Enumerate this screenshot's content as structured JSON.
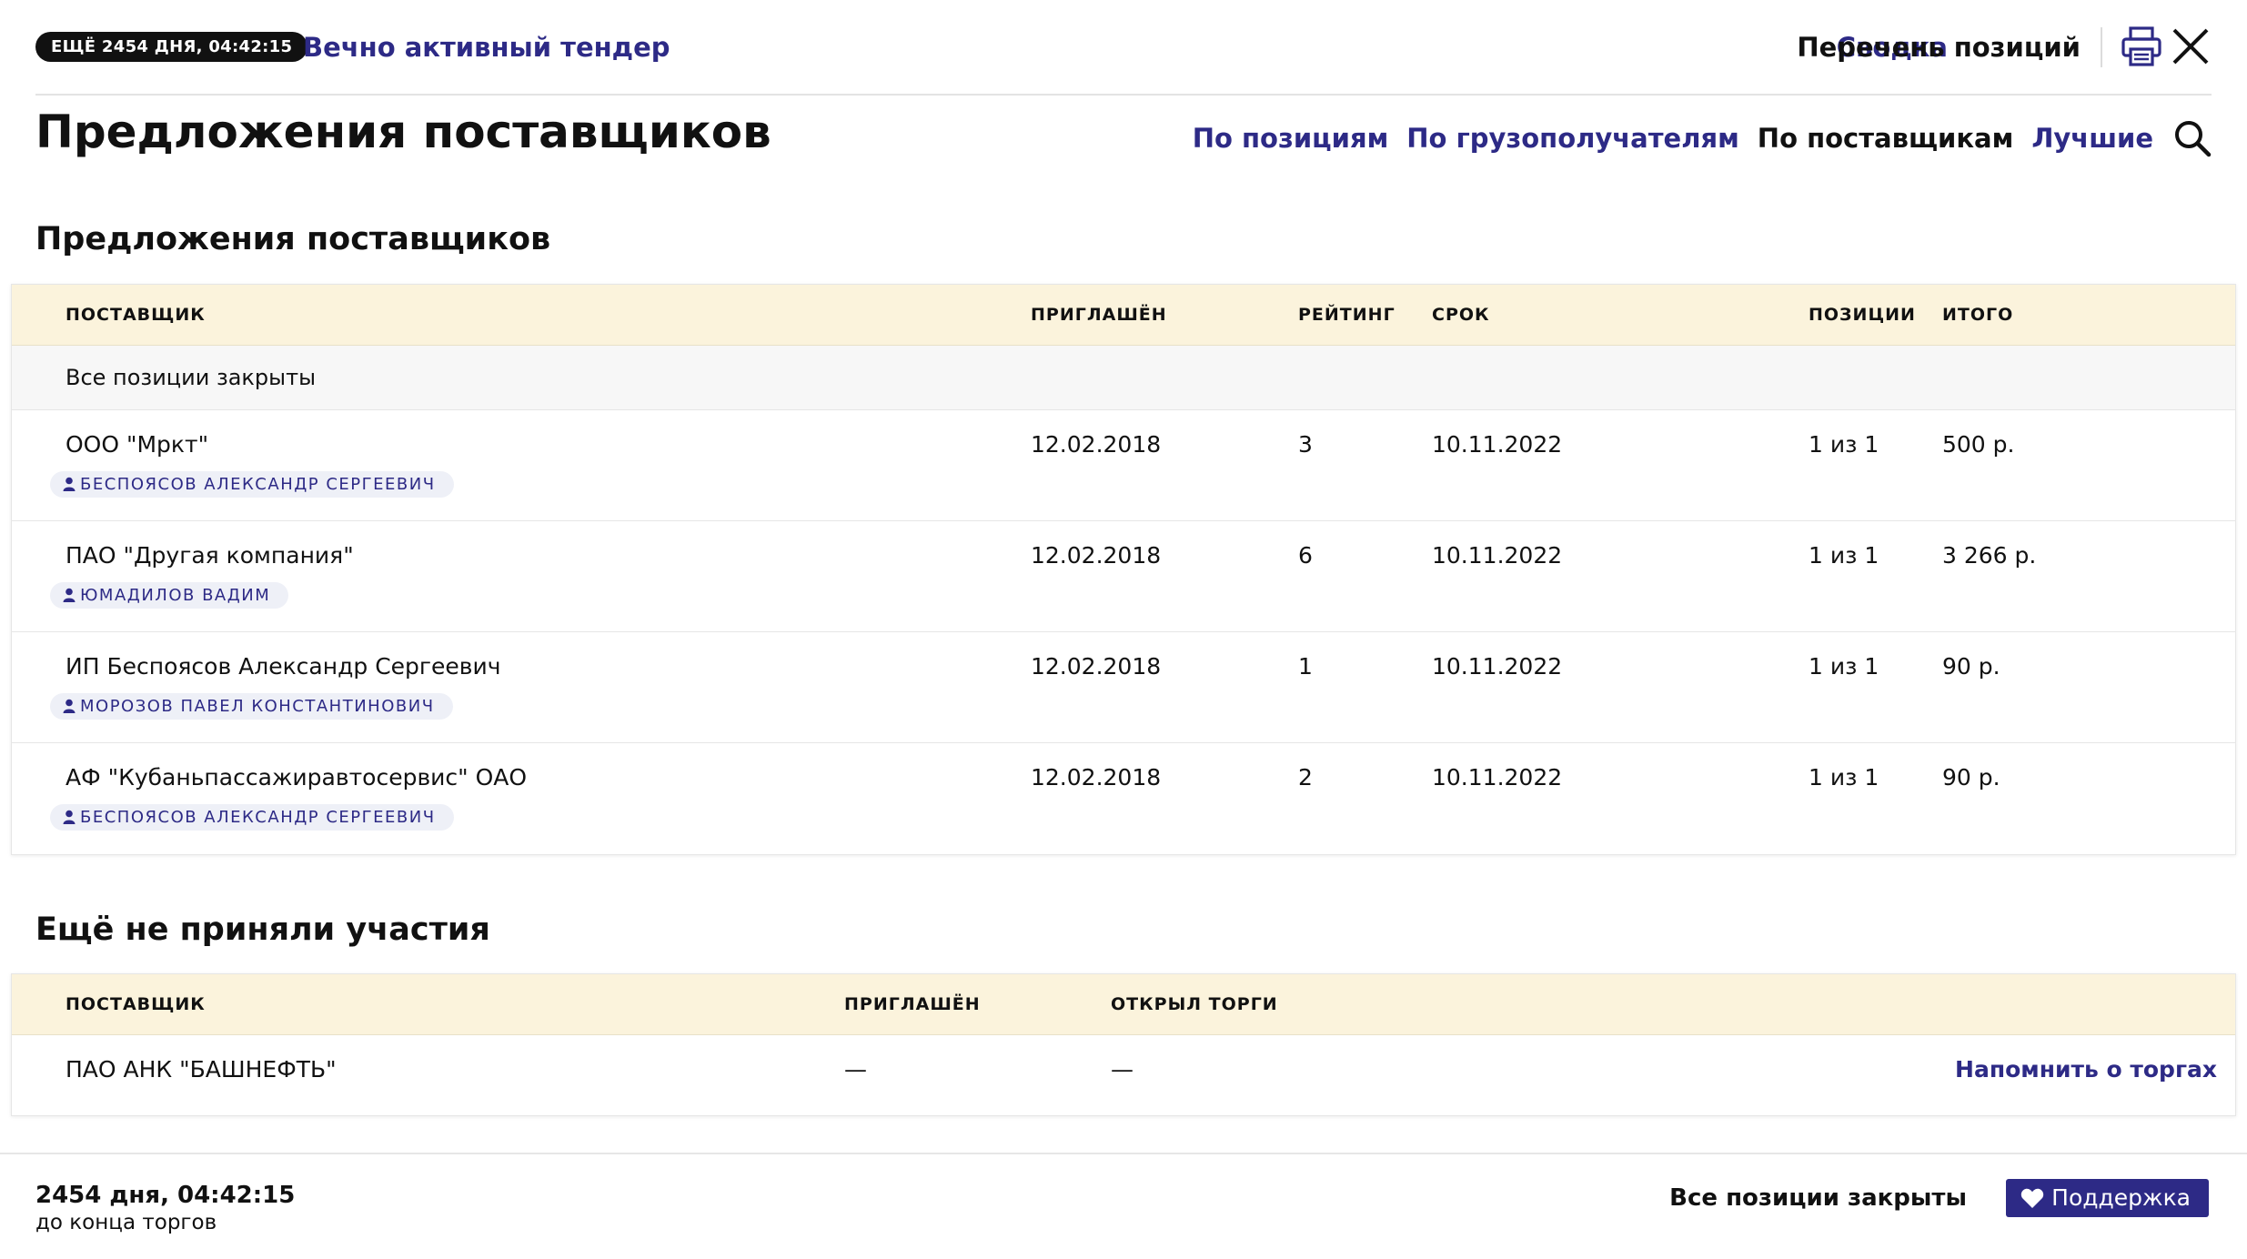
{
  "header": {
    "timer_badge": "ЕЩЁ 2454 ДНЯ, 04:42:15",
    "tender_title": "Вечно активный тендер",
    "nav_summary": "Сводка",
    "nav_positions_list": "Перечень позиций",
    "icons": {
      "print": "print-icon",
      "close": "close-icon"
    }
  },
  "page": {
    "title": "Предложения поставщиков",
    "view_tabs": [
      {
        "label": "По позициям",
        "active": false
      },
      {
        "label": "По грузополучателям",
        "active": false
      },
      {
        "label": "По поставщикам",
        "active": true
      },
      {
        "label": "Лучшие",
        "active": false
      }
    ],
    "search_icon": "search-icon"
  },
  "offers": {
    "section_title": "Предложения поставщиков",
    "columns": {
      "supplier": "ПОСТАВЩИК",
      "invited": "ПРИГЛАШЁН",
      "rating": "РЕЙТИНГ",
      "deadline": "СРОК",
      "positions": "ПОЗИЦИИ",
      "total": "ИТОГО"
    },
    "status_row": "Все позиции закрыты",
    "rows": [
      {
        "supplier": "ООО \"Мркт\"",
        "person": "БЕСПОЯСОВ АЛЕКСАНДР СЕРГЕЕВИЧ",
        "invited": "12.02.2018",
        "rating": "3",
        "deadline": "10.11.2022",
        "positions": "1 из 1",
        "total": "500 р."
      },
      {
        "supplier": "ПАО \"Другая компания\"",
        "person": "ЮМАДИЛОВ ВАДИМ",
        "invited": "12.02.2018",
        "rating": "6",
        "deadline": "10.11.2022",
        "positions": "1 из 1",
        "total": "3 266 р."
      },
      {
        "supplier": "ИП Беспоясов Александр Сергеевич",
        "person": "МОРОЗОВ ПАВЕЛ КОНСТАНТИНОВИЧ",
        "invited": "12.02.2018",
        "rating": "1",
        "deadline": "10.11.2022",
        "positions": "1 из 1",
        "total": "90 р."
      },
      {
        "supplier": "АФ \"Кубаньпассажиравтосервис\" ОАО",
        "person": "БЕСПОЯСОВ АЛЕКСАНДР СЕРГЕЕВИЧ",
        "invited": "12.02.2018",
        "rating": "2",
        "deadline": "10.11.2022",
        "positions": "1 из 1",
        "total": "90 р."
      }
    ]
  },
  "not_participated": {
    "section_title": "Ещё не приняли участия",
    "columns": {
      "supplier": "ПОСТАВЩИК",
      "invited": "ПРИГЛАШЁН",
      "opened": "ОТКРЫЛ ТОРГИ"
    },
    "rows": [
      {
        "supplier": "ПАО АНК \"БАШНЕФТЬ\"",
        "invited": "—",
        "opened": "—",
        "action": "Напомнить о торгах"
      }
    ]
  },
  "footer": {
    "timer": "2454 дня, 04:42:15",
    "timer_sub": "до конца торгов",
    "status": "Все позиции закрыты",
    "support_button": "Поддержка",
    "support_icon": "heart-icon"
  },
  "colors": {
    "accent": "#2d2a86",
    "table_header_bg": "#fbf3dc",
    "badge_bg": "#111111"
  }
}
